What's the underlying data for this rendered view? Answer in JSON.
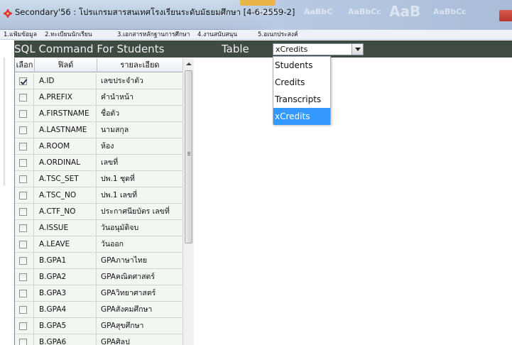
{
  "window": {
    "title": "Secondary'56 : โปรแกรมสารสนเทศโรงเรียนระดับมัธยมศึกษา [4-6-2559-2]",
    "background_words": [
      "AaBbC",
      "AaBbC",
      "AaBbCc",
      "AaB",
      "AaBbCc"
    ]
  },
  "menu": {
    "items": [
      "1.แฟ้มข้อมูล",
      "2.ทะเบียนนักเรียน",
      "3.เอกสารหลักฐานการศึกษา",
      "4.งานสนับสนุน",
      "5.อเนกประสงค์"
    ]
  },
  "header": {
    "title": "SQL Command For Students",
    "table_label": "Table",
    "selected_table": "xCredits"
  },
  "dropdown": {
    "options": [
      "Students",
      "Credits",
      "Transcripts",
      "xCredits"
    ],
    "selected_index": 3
  },
  "grid": {
    "columns": [
      "เลือก",
      "ฟิลด์",
      "รายละเอียด"
    ],
    "rows": [
      {
        "checked": true,
        "field": "A.ID",
        "desc": "เลขประจำตัว"
      },
      {
        "checked": false,
        "field": "A.PREFIX",
        "desc": "คำนำหน้า"
      },
      {
        "checked": false,
        "field": "A.FIRSTNAME",
        "desc": "ชื่อตัว"
      },
      {
        "checked": false,
        "field": "A.LASTNAME",
        "desc": "นามสกุล"
      },
      {
        "checked": false,
        "field": "A.ROOM",
        "desc": "ห้อง"
      },
      {
        "checked": false,
        "field": "A.ORDINAL",
        "desc": "เลขที่"
      },
      {
        "checked": false,
        "field": "A.TSC_SET",
        "desc": "ปพ.1 ชุดที่"
      },
      {
        "checked": false,
        "field": "A.TSC_NO",
        "desc": "ปพ.1 เลขที่"
      },
      {
        "checked": false,
        "field": "A.CTF_NO",
        "desc": "ประกาศนียบัตร เลขที่"
      },
      {
        "checked": false,
        "field": "A.ISSUE",
        "desc": "วันอนุมัติจบ"
      },
      {
        "checked": false,
        "field": "A.LEAVE",
        "desc": "วันออก"
      },
      {
        "checked": false,
        "field": "B.GPA1",
        "desc": "GPAภาษาไทย"
      },
      {
        "checked": false,
        "field": "B.GPA2",
        "desc": "GPAคณิตศาสตร์"
      },
      {
        "checked": false,
        "field": "B.GPA3",
        "desc": "GPAวิทยาศาสตร์"
      },
      {
        "checked": false,
        "field": "B.GPA4",
        "desc": "GPAสังคมศึกษา"
      },
      {
        "checked": false,
        "field": "B.GPA5",
        "desc": "GPAสุขศึกษา"
      },
      {
        "checked": false,
        "field": "B.GPA6",
        "desc": "GPAศิลป"
      }
    ]
  },
  "colors": {
    "header_strip": "#3f4a42",
    "selection": "#3399ff",
    "row_bg": "#f2f7f2"
  }
}
